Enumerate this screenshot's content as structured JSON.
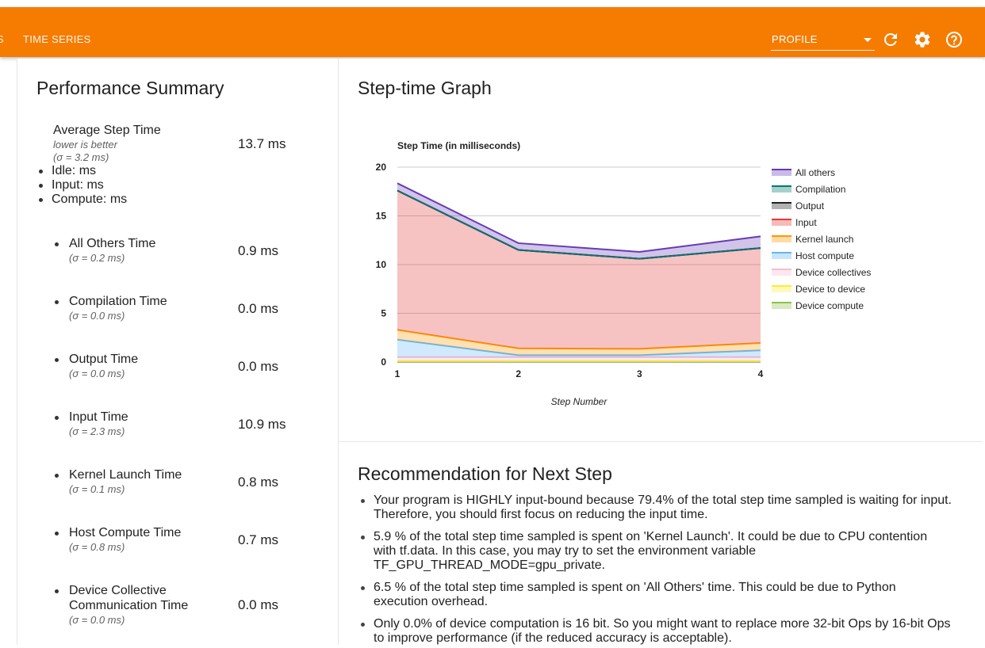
{
  "topbar": {
    "clipped_tab_label": "S",
    "tab_label": "TIME SERIES",
    "tool_select_value": "PROFILE",
    "refresh_icon": "refresh-icon",
    "settings_icon": "gear-icon",
    "help_icon": "help-circle-icon",
    "bg_color": "#f57c00"
  },
  "summary": {
    "title": "Performance Summary",
    "average": {
      "name": "Average Step Time",
      "hint": "lower is better",
      "sigma": "(σ = 3.2 ms)",
      "value": "13.7 ms"
    },
    "breakdown": [
      "Idle: ms",
      "Input: ms",
      "Compute: ms"
    ],
    "metrics": [
      {
        "name": "All Others Time",
        "sigma": "(σ = 0.2 ms)",
        "value": "0.9 ms"
      },
      {
        "name": "Compilation Time",
        "sigma": "(σ = 0.0 ms)",
        "value": "0.0 ms"
      },
      {
        "name": "Output Time",
        "sigma": "(σ = 0.0 ms)",
        "value": "0.0 ms"
      },
      {
        "name": "Input Time",
        "sigma": "(σ = 2.3 ms)",
        "value": "10.9 ms"
      },
      {
        "name": "Kernel Launch Time",
        "sigma": "(σ = 0.1 ms)",
        "value": "0.8 ms"
      },
      {
        "name": "Host Compute Time",
        "sigma": "(σ = 0.8 ms)",
        "value": "0.7 ms"
      },
      {
        "name_line1": "Device Collective",
        "name_line2": "Communication Time",
        "sigma": "(σ = 0.0 ms)",
        "value": "0.0 ms"
      }
    ]
  },
  "graph": {
    "title": "Step-time Graph"
  },
  "chart_data": {
    "type": "area",
    "title": "Step Time (in milliseconds)",
    "xlabel": "Step Number",
    "ylabel": "",
    "x": [
      1,
      2,
      3,
      4
    ],
    "ylim": [
      0,
      20
    ],
    "yticks": [
      0,
      5,
      10,
      15,
      20
    ],
    "stacked": true,
    "legend_position": "right",
    "series": [
      {
        "name": "Device compute",
        "color": "#8bc34a",
        "values": [
          0.05,
          0.05,
          0.05,
          0.05
        ]
      },
      {
        "name": "Device to device",
        "color": "#ffeb3b",
        "values": [
          0.05,
          0.05,
          0.05,
          0.05
        ]
      },
      {
        "name": "Device collectives",
        "color": "#f8bbd0",
        "values": [
          0.4,
          0.4,
          0.4,
          0.4
        ]
      },
      {
        "name": "Host compute",
        "color": "#64b5f6",
        "values": [
          1.8,
          0.2,
          0.2,
          0.7
        ]
      },
      {
        "name": "Kernel launch",
        "color": "#ff9800",
        "values": [
          1.0,
          0.7,
          0.65,
          0.75
        ]
      },
      {
        "name": "Input",
        "color": "#e53935",
        "values": [
          14.3,
          10.1,
          9.25,
          9.75
        ]
      },
      {
        "name": "Output",
        "color": "#212121",
        "values": [
          0.0,
          0.0,
          0.0,
          0.0
        ]
      },
      {
        "name": "Compilation",
        "color": "#00796b",
        "values": [
          0.0,
          0.0,
          0.0,
          0.0
        ]
      },
      {
        "name": "All others",
        "color": "#673ab7",
        "values": [
          0.75,
          0.7,
          0.7,
          1.2
        ]
      }
    ],
    "legend_order": [
      "All others",
      "Compilation",
      "Output",
      "Input",
      "Kernel launch",
      "Host compute",
      "Device collectives",
      "Device to device",
      "Device compute"
    ]
  },
  "recommendation": {
    "title": "Recommendation for Next Step",
    "items": [
      {
        "line1": "Your program is HIGHLY input-bound because 79.4% of the total step time sampled is waiting for input.",
        "line2": "Therefore, you should first focus on reducing the input time."
      },
      {
        "line1": "5.9 % of the total step time sampled is spent on 'Kernel Launch'. It could be due to CPU contention",
        "line2": "with tf.data. In this case, you may try to set the environment variable",
        "line3": "TF_GPU_THREAD_MODE=gpu_private."
      },
      {
        "line1": "6.5 % of the total step time sampled is spent on 'All Others' time. This could be due to Python",
        "line2": "execution overhead."
      },
      {
        "line1": "Only 0.0% of device computation is 16 bit. So you might want to replace more 32-bit Ops by 16-bit Ops",
        "line2": "to improve performance (if the reduced accuracy is acceptable)."
      }
    ]
  }
}
